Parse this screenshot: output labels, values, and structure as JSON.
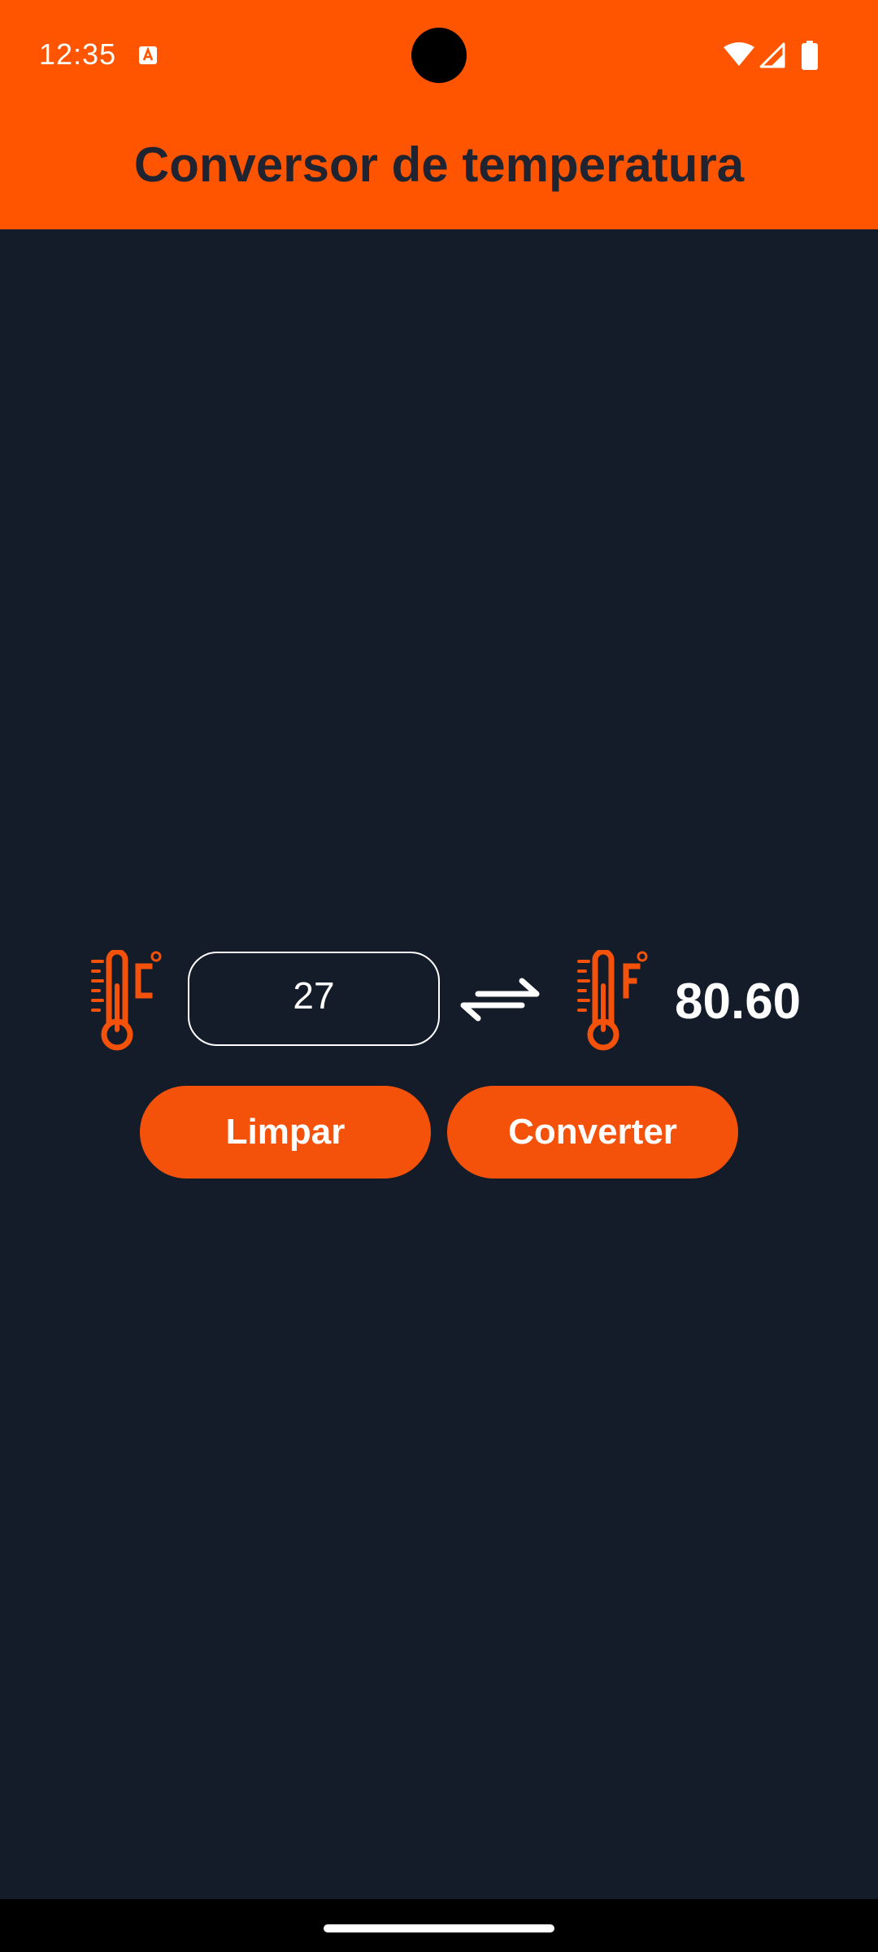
{
  "status_bar": {
    "time": "12:35",
    "icons": [
      "text-notification-icon",
      "wifi-icon",
      "cell-signal-icon",
      "battery-icon"
    ]
  },
  "app": {
    "title": "Conversor de temperatura"
  },
  "converter": {
    "input_value": "27",
    "input_unit_icon": "thermometer-celsius-icon",
    "swap_icon": "swap-arrows-icon",
    "output_unit_icon": "thermometer-fahrenheit-icon",
    "result": "80.60"
  },
  "buttons": {
    "clear_label": "Limpar",
    "convert_label": "Converter"
  },
  "colors": {
    "accent": "#ff5500",
    "button": "#f4520a",
    "background": "#141c29",
    "title_text": "#1f2430",
    "text": "#ffffff"
  }
}
